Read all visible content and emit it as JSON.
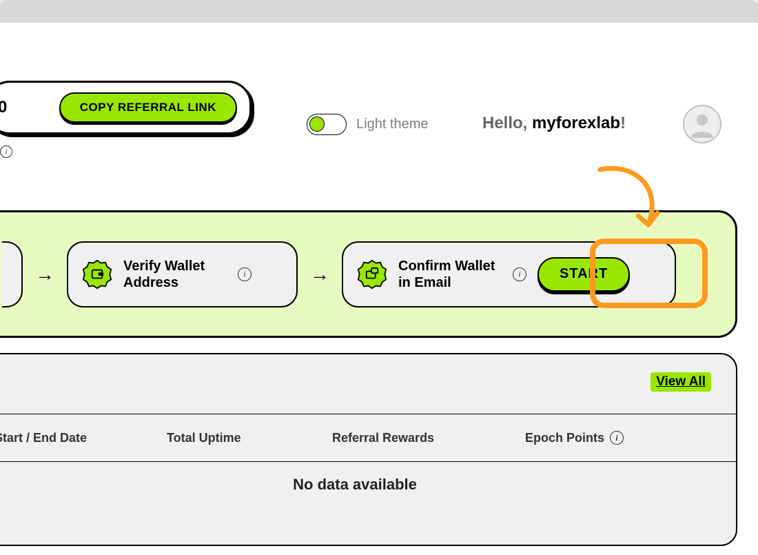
{
  "header": {
    "referral_value": "0",
    "copy_referral_label": "COPY REFERRAL LINK",
    "theme_label": "Light theme",
    "greeting_prefix": "Hello, ",
    "username": "myforexlab",
    "greeting_suffix": "!"
  },
  "steps": {
    "verify_label": "Verify Wallet Address",
    "confirm_label": "Confirm Wallet in Email",
    "start_label": "START"
  },
  "table": {
    "view_all_label": "View All",
    "columns": {
      "dates": "Start / End Date",
      "uptime": "Total Uptime",
      "referral_rewards": "Referral Rewards",
      "epoch_points": "Epoch Points"
    },
    "empty_message": "No data available"
  },
  "colors": {
    "accent": "#99e600",
    "highlight": "#ff9a1f"
  }
}
